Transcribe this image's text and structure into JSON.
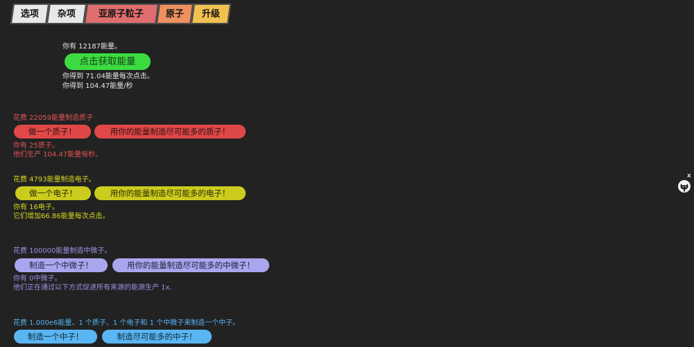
{
  "tabs": [
    {
      "label": "选项"
    },
    {
      "label": "杂项"
    },
    {
      "label": "亚原子粒子"
    },
    {
      "label": "原子"
    },
    {
      "label": "升级"
    }
  ],
  "energy": {
    "have": "你有 12187能量。",
    "click_button": "点击获取能量",
    "per_click": "你得到 71.04能量每次点击。",
    "per_second": "你得到 104.47能量/秒"
  },
  "proton": {
    "cost": "花费 22059能量制造质子",
    "make_one": "做一个质子！",
    "make_max": "用你的能量制造尽可能多的质子！",
    "have": "你有 25质子。",
    "effect": "他们生产 104.47能量每秒。"
  },
  "electron": {
    "cost": "花费 4793能量制造电子。",
    "make_one": "做一个电子！",
    "make_max": "用你的能量制造尽可能多的电子！",
    "have": "你有 16电子。",
    "effect": "它们增加66.86能量每次点击。"
  },
  "neutrino": {
    "cost": "花费 100000能量制造中微子。",
    "make_one": "制造一个中微子！",
    "make_max": "用你的能量制造尽可能多的中微子！",
    "have": "你有 0中微子。",
    "effect": "他们正在通过以下方式促进所有来源的能源生产 1x."
  },
  "neutron": {
    "cost": "花费 1.000e6能量、1 个质子、1 个电子和 1 个中微子来制造一个中子。",
    "make_one": "制造一个中子！",
    "make_max": "制造尽可能多的中子！"
  },
  "widget": {
    "close": "x",
    "icon": "github-cat-icon"
  }
}
